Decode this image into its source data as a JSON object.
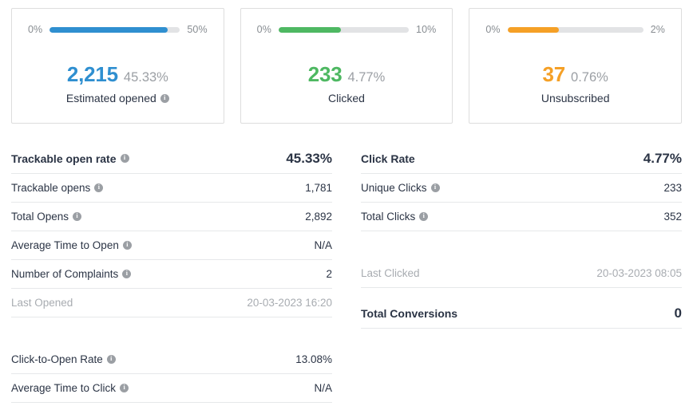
{
  "cards": [
    {
      "name": "estimated-opened",
      "bar_min": "0%",
      "bar_max": "50%",
      "count": "2,215",
      "percent": "45.33%",
      "label": "Estimated opened",
      "has_info": true,
      "color": "#2f8fd0",
      "fill_ratio": 90.7
    },
    {
      "name": "clicked",
      "bar_min": "0%",
      "bar_max": "10%",
      "count": "233",
      "percent": "4.77%",
      "label": "Clicked",
      "has_info": false,
      "color": "#4eb862",
      "fill_ratio": 47.7
    },
    {
      "name": "unsubscribed",
      "bar_min": "0%",
      "bar_max": "2%",
      "count": "37",
      "percent": "0.76%",
      "label": "Unsubscribed",
      "has_info": false,
      "color": "#f5a026",
      "fill_ratio": 38.0
    }
  ],
  "left_table": {
    "header": {
      "label": "Trackable open rate",
      "value": "45.33%",
      "has_info": true
    },
    "rows": [
      {
        "label": "Trackable opens",
        "value": "1,781",
        "has_info": true,
        "muted": false
      },
      {
        "label": "Total Opens",
        "value": "2,892",
        "has_info": true,
        "muted": false
      },
      {
        "label": "Average Time to Open",
        "value": "N/A",
        "has_info": true,
        "muted": false
      },
      {
        "label": "Number of Complaints",
        "value": "2",
        "has_info": true,
        "muted": false
      },
      {
        "label": "Last Opened",
        "value": "20-03-2023 16:20",
        "has_info": false,
        "muted": true
      }
    ]
  },
  "left_table_2": {
    "rows": [
      {
        "label": "Click-to-Open Rate",
        "value": "13.08%",
        "has_info": true,
        "muted": false
      },
      {
        "label": "Average Time to Click",
        "value": "N/A",
        "has_info": true,
        "muted": false
      }
    ]
  },
  "right_table": {
    "header": {
      "label": "Click Rate",
      "value": "4.77%",
      "has_info": false
    },
    "rows": [
      {
        "label": "Unique Clicks",
        "value": "233",
        "has_info": true,
        "muted": false
      },
      {
        "label": "Total Clicks",
        "value": "352",
        "has_info": true,
        "muted": false
      }
    ],
    "late_row": {
      "label": "Last Clicked",
      "value": "20-03-2023 08:05",
      "has_info": false,
      "muted": true
    }
  },
  "right_table_2": {
    "header": {
      "label": "Total Conversions",
      "value": "0",
      "has_info": false
    }
  }
}
